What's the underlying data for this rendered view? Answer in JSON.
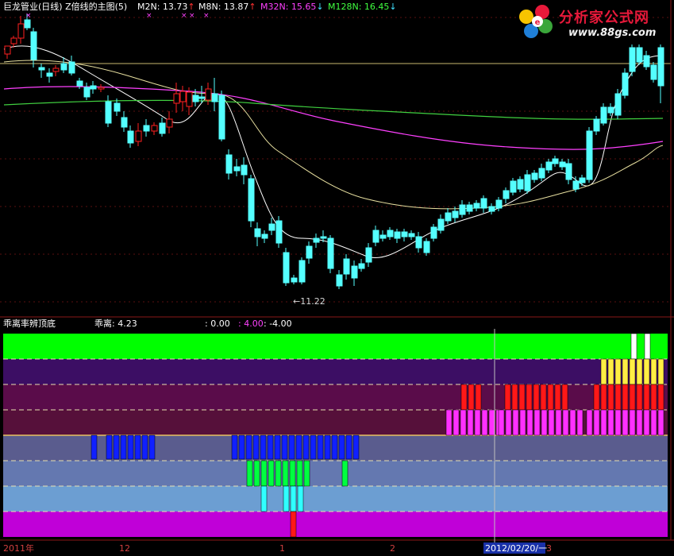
{
  "header": {
    "title": "巨龙管业(日线) Z倍线的主图(5)",
    "indicators": [
      {
        "label": "M2N: 13.73",
        "arrow": "↑",
        "color": "#ffffff",
        "arrow_color": "#ff3030"
      },
      {
        "label": "M8N: 13.87",
        "arrow": "↑",
        "color": "#ffffff",
        "arrow_color": "#ff3030"
      },
      {
        "label": "M32N: 15.65",
        "arrow": "↓",
        "color": "#ff40ff",
        "arrow_color": "#40e0ff"
      },
      {
        "label": "M128N: 16.45",
        "arrow": "↓",
        "color": "#40ff40",
        "arrow_color": "#40e0ff"
      }
    ],
    "marker": "×"
  },
  "logo": {
    "name": "分析家公式网",
    "url": "www.88gs.com"
  },
  "main_chart": {
    "low_annotation": "←11.22"
  },
  "sub_panel": {
    "title": "乖离率辨顶底",
    "value_label": "乖离: 4.23",
    "level_zero": ": 0.00",
    "level_pos": ": 4.00",
    "level_neg": ": -4.00"
  },
  "x_axis": {
    "labels": [
      "2011年",
      "12",
      "1",
      "2",
      "2012/02/20/一",
      "3"
    ]
  },
  "colors": {
    "up_candle": "#ff2020",
    "down_candle": "#54ffff",
    "ma_white": "#ffffff",
    "ma_yellow": "#e8e0a0",
    "ma_magenta": "#ff40ff",
    "ma_green": "#40d040",
    "band_green": "#00ff00",
    "band_purple": "#3c0e64",
    "band_maroon1": "#5a0c4a",
    "band_maroon2": "#56103a",
    "band_slate1": "#5a5c8e",
    "band_slate2": "#6478b0",
    "band_slate3": "#6c9ed2",
    "band_magenta": "#c000d8"
  }
}
